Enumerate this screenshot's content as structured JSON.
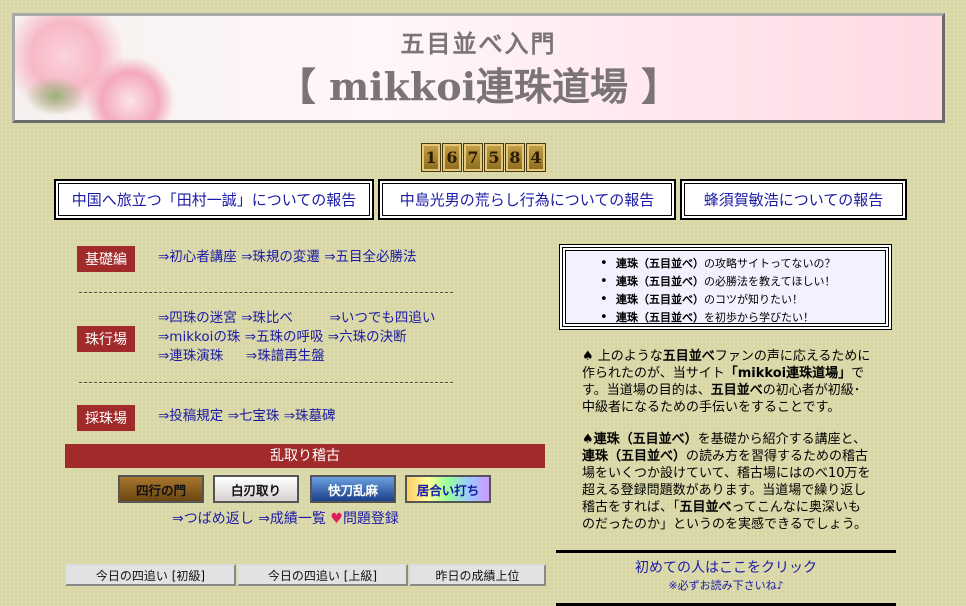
{
  "header": {
    "subtitle": "五目並べ入門",
    "title": "【 mikkoi連珠道場 】"
  },
  "counter": {
    "digits": [
      "1",
      "6",
      "7",
      "5",
      "8",
      "4"
    ]
  },
  "reports": [
    {
      "label": "中国へ旅立つ「田村一誠」についての報告"
    },
    {
      "label": "中島光男の荒らし行為についての報告"
    },
    {
      "label": "蜂須賀敏浩についての報告"
    }
  ],
  "sections": {
    "kiso": {
      "label": "基礎編",
      "links": [
        "⇒初心者講座",
        "⇒珠規の変遷",
        "⇒五目全必勝法"
      ]
    },
    "shugyo": {
      "label": "珠行場",
      "row1": [
        "⇒四珠の迷宮",
        "⇒珠比べ",
        "⇒いつでも四追い"
      ],
      "row2": [
        "⇒mikkoiの珠",
        "⇒五珠の呼吸",
        "⇒六珠の決断"
      ],
      "row3": [
        "⇒連珠演珠",
        "⇒珠譜再生盤"
      ]
    },
    "saishu": {
      "label": "採珠場",
      "links": [
        "⇒投稿規定",
        "⇒七宝珠",
        "⇒珠墓碑"
      ]
    }
  },
  "randori": {
    "label": "乱取り稽古",
    "buttons": [
      "四行の門",
      "白刃取り",
      "快刀乱麻",
      "居合い打ち"
    ],
    "links": [
      "⇒つばめ返し",
      "⇒成績一覧"
    ],
    "heart": "♥",
    "register": "問題登録"
  },
  "tabs": [
    "今日の四追い [初級]",
    "今日の四追い [上級]",
    "昨日の成績上位"
  ],
  "questions": [
    {
      "bold": "連珠（五目並べ）",
      "rest": "の攻略サイトってないの？"
    },
    {
      "bold": "連珠（五目並べ）",
      "rest": "の必勝法を教えてほしい！"
    },
    {
      "bold": "連珠（五目並べ）",
      "rest": "のコツが知りたい！"
    },
    {
      "bold": "連珠（五目並べ）",
      "rest": "を初歩から学びたい！"
    }
  ],
  "intro1": {
    "p1": "♠ 上のような",
    "b1": "五目並べ",
    "p2": "ファンの声に応えるために作られたのが、当サイト",
    "b2": "「mikkoi連珠道場」",
    "p3": "です。当道場の目的は、",
    "b3": "五目並べ",
    "p4": "の初心者が初級･中級者になるための手伝いをすることです。"
  },
  "intro2": {
    "p1": "♠",
    "b1": "連珠（五目並べ）",
    "p2": "を基礎から紹介する講座と、",
    "b2": "連珠（五目並べ）",
    "p3": "の読み方を習得するための稽古場をいくつか設けていて、稽古場にはのべ10万を超える登録問題数があります。当道場で繰り返し稽古をすれば、「",
    "b3": "五目並べ",
    "p4": "ってこんなに奥深いものだったのか」というのを実感できるでしょう。"
  },
  "first_time": {
    "link": "初めての人はここをクリック",
    "note": "※必ずお読み下さいね♪"
  }
}
